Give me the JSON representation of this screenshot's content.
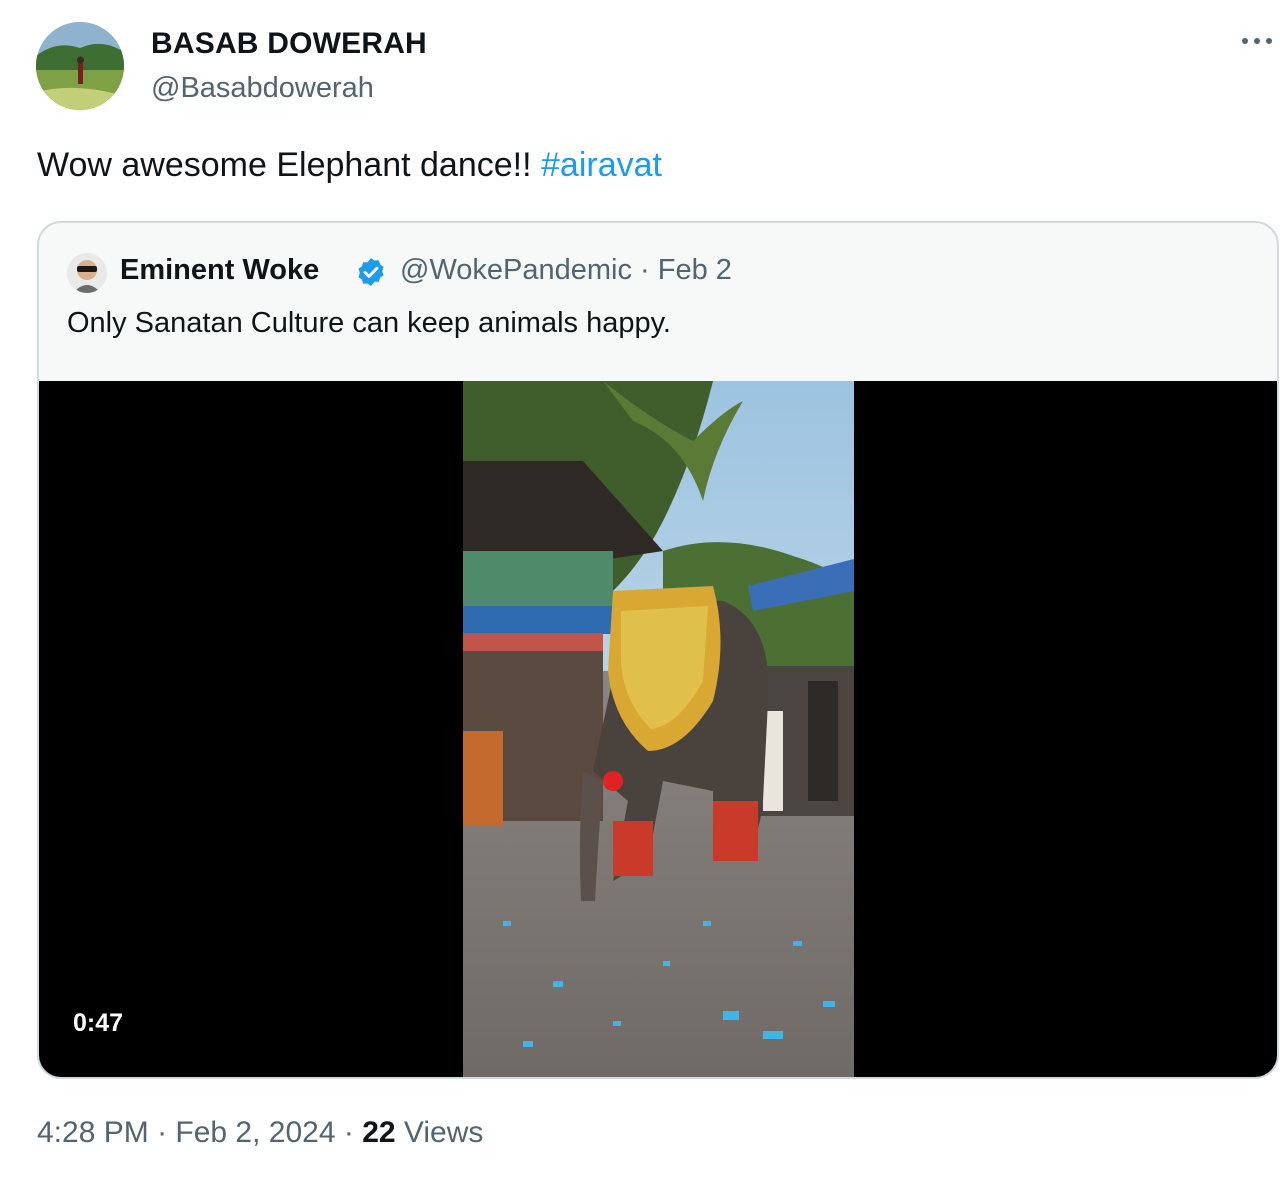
{
  "author": {
    "display_name": "BASAB DOWERAH",
    "handle": "@Basabdowerah"
  },
  "more_icon": "more-horizontal-icon",
  "tweet": {
    "text": "Wow awesome Elephant dance!! ",
    "hashtag": "#airavat",
    "hashtag_color": "#1d9bf0"
  },
  "quoted_tweet": {
    "display_name": "Eminent Woke",
    "verified_icon": "verified-badge-icon",
    "verified_color": "#1d9bf0",
    "handle": "@WokePandemic",
    "separator": " · ",
    "date": "Feb 2",
    "text": "Only Sanatan Culture can keep animals happy.",
    "video": {
      "duration": "0:47"
    }
  },
  "meta": {
    "time": "4:28 PM",
    "separator": " · ",
    "date": "Feb 2, 2024",
    "views_count": "22",
    "views_label": " Views"
  },
  "colors": {
    "text_primary": "#0f1419",
    "text_secondary": "#536471",
    "border": "#cfd9de"
  }
}
